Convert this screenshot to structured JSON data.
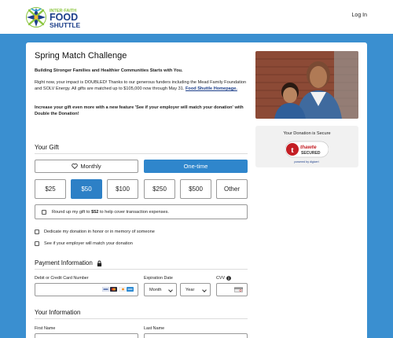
{
  "header": {
    "logo_text": "INTER-FAITH FOOD SHUTTLE",
    "login_label": "Log In"
  },
  "campaign": {
    "title": "Spring Match Challenge",
    "tagline": "Building Stronger Families and Healthier Communities Starts with You.",
    "body_text": "Right now, your impact is DOUBLED! Thanks to our generous funders including the Mead Family Foundation and SOLV Energy. All gifts are matched up to $105,000 now through May 31.",
    "homepage_link": "Food Shuttle Homepage.",
    "employer_cta": "Increase your gift even more with a new feature 'See if your employer will match your donation' with Double the Donation!"
  },
  "gift": {
    "heading": "Your Gift",
    "frequency_monthly": "Monthly",
    "frequency_onetime": "One-time",
    "selected_frequency": "One-time",
    "amounts": [
      "$25",
      "$50",
      "$100",
      "$250",
      "$500",
      "Other"
    ],
    "selected_amount": "$50",
    "roundup_prefix": "Round up my gift to",
    "roundup_amount": "$52",
    "roundup_suffix": "to help cover transaction expenses.",
    "dedicate_label": "Dedicate my donation in honor or in memory of someone",
    "employer_match_label": "See if your employer will match your donation"
  },
  "payment": {
    "heading": "Payment Information",
    "card_label": "Debit or Credit Card Number",
    "expiration_label": "Expiration Date",
    "month_value": "Month",
    "year_value": "Year",
    "cvv_label": "CVV",
    "card_brands": [
      "visa",
      "mastercard",
      "discover",
      "amex"
    ]
  },
  "info": {
    "heading": "Your Information",
    "first_name_label": "First Name",
    "last_name_label": "Last Name"
  },
  "security": {
    "title": "Your Donation is Secure",
    "seal_text": "thawte SECURED",
    "seal_sub": "powered by digicert"
  },
  "colors": {
    "page_bg": "#3a8fd0",
    "accent": "#2d80c6",
    "logo_navy": "#1d3f8a",
    "logo_green": "#8cc63f"
  }
}
